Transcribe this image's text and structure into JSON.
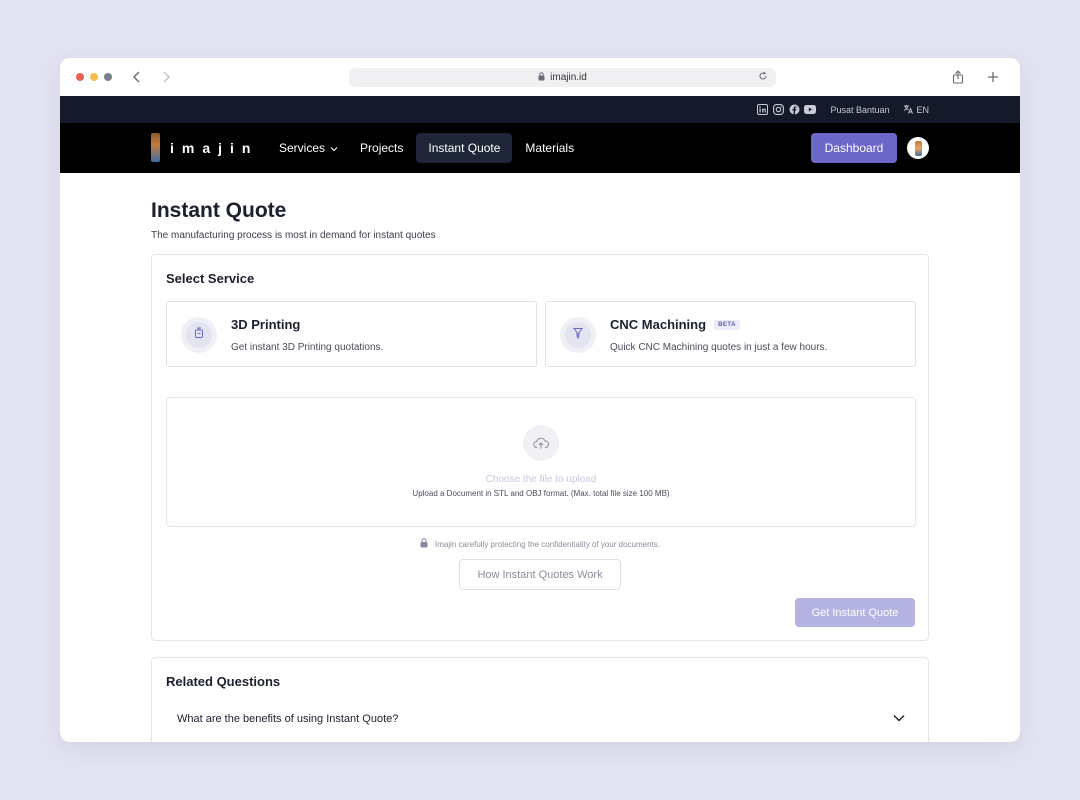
{
  "browser": {
    "url": "imajin.id"
  },
  "topbar": {
    "help_link": "Pusat Bantuan",
    "language": "EN",
    "socials": [
      "linkedin-icon",
      "instagram-icon",
      "facebook-icon",
      "youtube-icon"
    ]
  },
  "nav": {
    "logo_text": "imajin",
    "items": [
      {
        "label": "Services",
        "has_dropdown": true
      },
      {
        "label": "Projects"
      },
      {
        "label": "Instant Quote",
        "active": true
      },
      {
        "label": "Materials"
      }
    ],
    "dashboard_label": "Dashboard"
  },
  "page": {
    "title": "Instant Quote",
    "subtitle": "The manufacturing process is most in demand for instant quotes"
  },
  "select_service": {
    "title": "Select Service",
    "services": [
      {
        "name": "3D Printing",
        "desc": "Get instant 3D Printing quotations.",
        "badge": ""
      },
      {
        "name": "CNC Machining",
        "desc": "Quick CNC Machining quotes in just a few hours.",
        "badge": "BETA"
      }
    ],
    "upload": {
      "title": "Choose the file to upload",
      "hint": "Upload a Document in STL and OBJ format. (Max. total file size 100 MB)"
    },
    "secure_note": "Imajin carefully protecting the confidentiality of your documents.",
    "how_button": "How Instant Quotes Work",
    "submit_button": "Get Instant Quote"
  },
  "related": {
    "title": "Related Questions",
    "questions": [
      "What are the benefits of using Instant Quote?"
    ]
  },
  "colors": {
    "accent": "#6b67c8",
    "accent_disabled": "#b5b3e2",
    "nav_bg": "#000000",
    "topbar_bg": "#141a2a"
  }
}
